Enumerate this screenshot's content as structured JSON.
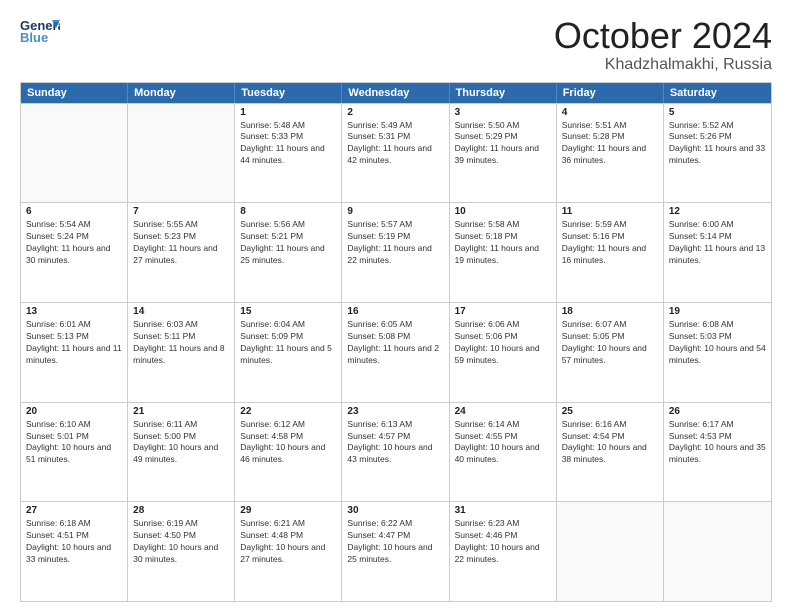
{
  "header": {
    "logo_line1": "General",
    "logo_line2": "Blue",
    "title": "October 2024",
    "location": "Khadzhalmakhi, Russia"
  },
  "days_of_week": [
    "Sunday",
    "Monday",
    "Tuesday",
    "Wednesday",
    "Thursday",
    "Friday",
    "Saturday"
  ],
  "rows": [
    [
      {
        "day": "",
        "sunrise": "",
        "sunset": "",
        "daylight": "",
        "empty": true
      },
      {
        "day": "",
        "sunrise": "",
        "sunset": "",
        "daylight": "",
        "empty": true
      },
      {
        "day": "1",
        "sunrise": "Sunrise: 5:48 AM",
        "sunset": "Sunset: 5:33 PM",
        "daylight": "Daylight: 11 hours and 44 minutes."
      },
      {
        "day": "2",
        "sunrise": "Sunrise: 5:49 AM",
        "sunset": "Sunset: 5:31 PM",
        "daylight": "Daylight: 11 hours and 42 minutes."
      },
      {
        "day": "3",
        "sunrise": "Sunrise: 5:50 AM",
        "sunset": "Sunset: 5:29 PM",
        "daylight": "Daylight: 11 hours and 39 minutes."
      },
      {
        "day": "4",
        "sunrise": "Sunrise: 5:51 AM",
        "sunset": "Sunset: 5:28 PM",
        "daylight": "Daylight: 11 hours and 36 minutes."
      },
      {
        "day": "5",
        "sunrise": "Sunrise: 5:52 AM",
        "sunset": "Sunset: 5:26 PM",
        "daylight": "Daylight: 11 hours and 33 minutes."
      }
    ],
    [
      {
        "day": "6",
        "sunrise": "Sunrise: 5:54 AM",
        "sunset": "Sunset: 5:24 PM",
        "daylight": "Daylight: 11 hours and 30 minutes."
      },
      {
        "day": "7",
        "sunrise": "Sunrise: 5:55 AM",
        "sunset": "Sunset: 5:23 PM",
        "daylight": "Daylight: 11 hours and 27 minutes."
      },
      {
        "day": "8",
        "sunrise": "Sunrise: 5:56 AM",
        "sunset": "Sunset: 5:21 PM",
        "daylight": "Daylight: 11 hours and 25 minutes."
      },
      {
        "day": "9",
        "sunrise": "Sunrise: 5:57 AM",
        "sunset": "Sunset: 5:19 PM",
        "daylight": "Daylight: 11 hours and 22 minutes."
      },
      {
        "day": "10",
        "sunrise": "Sunrise: 5:58 AM",
        "sunset": "Sunset: 5:18 PM",
        "daylight": "Daylight: 11 hours and 19 minutes."
      },
      {
        "day": "11",
        "sunrise": "Sunrise: 5:59 AM",
        "sunset": "Sunset: 5:16 PM",
        "daylight": "Daylight: 11 hours and 16 minutes."
      },
      {
        "day": "12",
        "sunrise": "Sunrise: 6:00 AM",
        "sunset": "Sunset: 5:14 PM",
        "daylight": "Daylight: 11 hours and 13 minutes."
      }
    ],
    [
      {
        "day": "13",
        "sunrise": "Sunrise: 6:01 AM",
        "sunset": "Sunset: 5:13 PM",
        "daylight": "Daylight: 11 hours and 11 minutes."
      },
      {
        "day": "14",
        "sunrise": "Sunrise: 6:03 AM",
        "sunset": "Sunset: 5:11 PM",
        "daylight": "Daylight: 11 hours and 8 minutes."
      },
      {
        "day": "15",
        "sunrise": "Sunrise: 6:04 AM",
        "sunset": "Sunset: 5:09 PM",
        "daylight": "Daylight: 11 hours and 5 minutes."
      },
      {
        "day": "16",
        "sunrise": "Sunrise: 6:05 AM",
        "sunset": "Sunset: 5:08 PM",
        "daylight": "Daylight: 11 hours and 2 minutes."
      },
      {
        "day": "17",
        "sunrise": "Sunrise: 6:06 AM",
        "sunset": "Sunset: 5:06 PM",
        "daylight": "Daylight: 10 hours and 59 minutes."
      },
      {
        "day": "18",
        "sunrise": "Sunrise: 6:07 AM",
        "sunset": "Sunset: 5:05 PM",
        "daylight": "Daylight: 10 hours and 57 minutes."
      },
      {
        "day": "19",
        "sunrise": "Sunrise: 6:08 AM",
        "sunset": "Sunset: 5:03 PM",
        "daylight": "Daylight: 10 hours and 54 minutes."
      }
    ],
    [
      {
        "day": "20",
        "sunrise": "Sunrise: 6:10 AM",
        "sunset": "Sunset: 5:01 PM",
        "daylight": "Daylight: 10 hours and 51 minutes."
      },
      {
        "day": "21",
        "sunrise": "Sunrise: 6:11 AM",
        "sunset": "Sunset: 5:00 PM",
        "daylight": "Daylight: 10 hours and 49 minutes."
      },
      {
        "day": "22",
        "sunrise": "Sunrise: 6:12 AM",
        "sunset": "Sunset: 4:58 PM",
        "daylight": "Daylight: 10 hours and 46 minutes."
      },
      {
        "day": "23",
        "sunrise": "Sunrise: 6:13 AM",
        "sunset": "Sunset: 4:57 PM",
        "daylight": "Daylight: 10 hours and 43 minutes."
      },
      {
        "day": "24",
        "sunrise": "Sunrise: 6:14 AM",
        "sunset": "Sunset: 4:55 PM",
        "daylight": "Daylight: 10 hours and 40 minutes."
      },
      {
        "day": "25",
        "sunrise": "Sunrise: 6:16 AM",
        "sunset": "Sunset: 4:54 PM",
        "daylight": "Daylight: 10 hours and 38 minutes."
      },
      {
        "day": "26",
        "sunrise": "Sunrise: 6:17 AM",
        "sunset": "Sunset: 4:53 PM",
        "daylight": "Daylight: 10 hours and 35 minutes."
      }
    ],
    [
      {
        "day": "27",
        "sunrise": "Sunrise: 6:18 AM",
        "sunset": "Sunset: 4:51 PM",
        "daylight": "Daylight: 10 hours and 33 minutes."
      },
      {
        "day": "28",
        "sunrise": "Sunrise: 6:19 AM",
        "sunset": "Sunset: 4:50 PM",
        "daylight": "Daylight: 10 hours and 30 minutes."
      },
      {
        "day": "29",
        "sunrise": "Sunrise: 6:21 AM",
        "sunset": "Sunset: 4:48 PM",
        "daylight": "Daylight: 10 hours and 27 minutes."
      },
      {
        "day": "30",
        "sunrise": "Sunrise: 6:22 AM",
        "sunset": "Sunset: 4:47 PM",
        "daylight": "Daylight: 10 hours and 25 minutes."
      },
      {
        "day": "31",
        "sunrise": "Sunrise: 6:23 AM",
        "sunset": "Sunset: 4:46 PM",
        "daylight": "Daylight: 10 hours and 22 minutes."
      },
      {
        "day": "",
        "sunrise": "",
        "sunset": "",
        "daylight": "",
        "empty": true
      },
      {
        "day": "",
        "sunrise": "",
        "sunset": "",
        "daylight": "",
        "empty": true
      }
    ]
  ]
}
